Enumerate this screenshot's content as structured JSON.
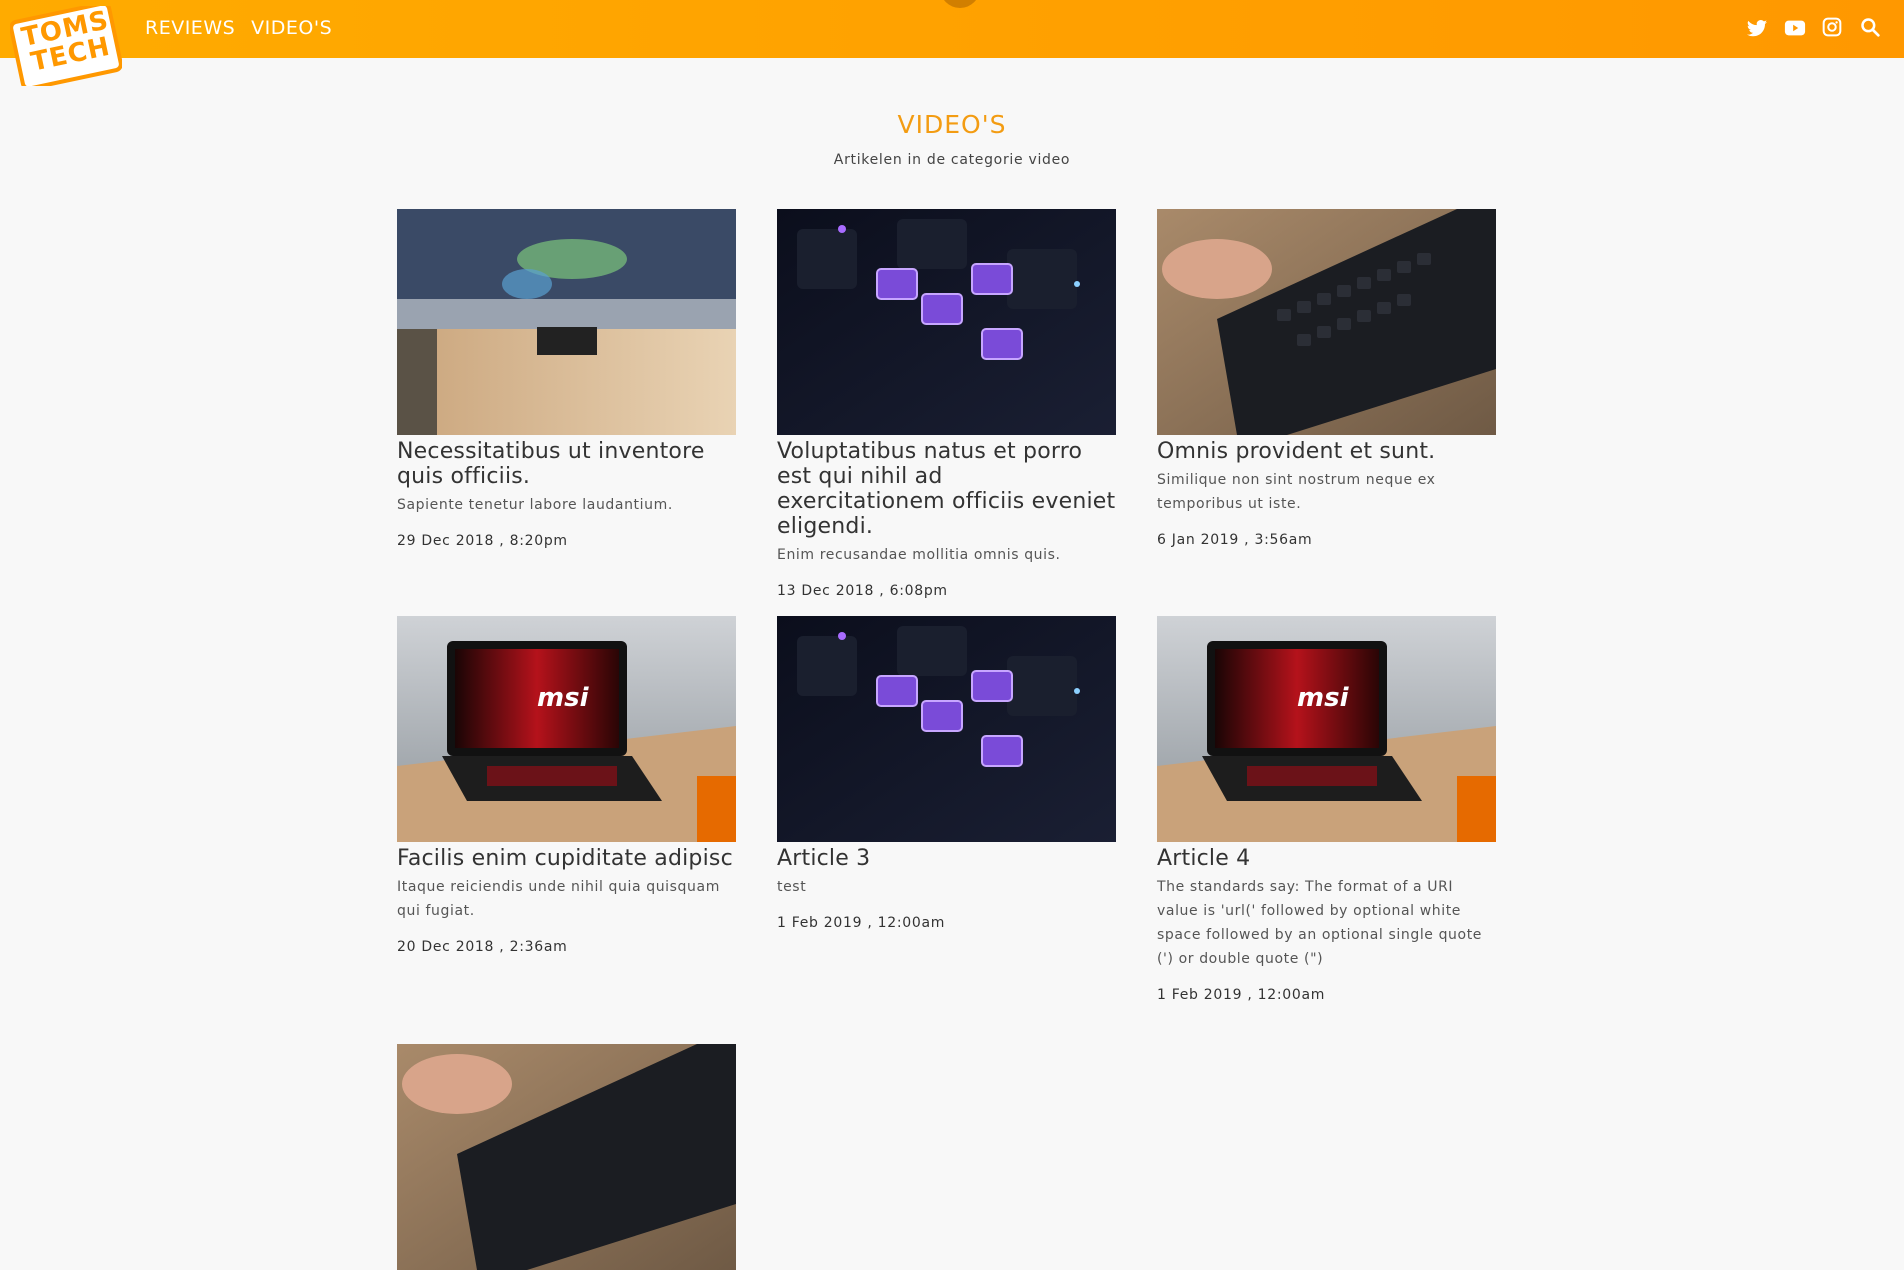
{
  "header": {
    "logo_top": "TOMS",
    "logo_bottom": "TECH",
    "nav": [
      "REVIEWS",
      "VIDEO'S"
    ],
    "social": [
      {
        "name": "twitter-icon"
      },
      {
        "name": "youtube-icon"
      },
      {
        "name": "instagram-icon"
      },
      {
        "name": "search-icon"
      }
    ],
    "colors": {
      "accent": "#ff9800",
      "title": "#f39c12"
    }
  },
  "page": {
    "title": "VIDEO'S",
    "subtitle": "Artikelen in de categorie video"
  },
  "articles": [
    {
      "title": "Necessitatibus ut inventore quis officiis.",
      "excerpt": "Sapiente tenetur labore laudantium.",
      "date": "29 Dec 2018 , 8:20pm",
      "image": "monitor"
    },
    {
      "title": "Voluptatibus natus et porro est qui nihil ad exercitationem officiis eveniet eligendi.",
      "excerpt": "Enim recusandae mollitia omnis quis.",
      "date": "13 Dec 2018 , 6:08pm",
      "image": "switches"
    },
    {
      "title": "Omnis provident et sunt.",
      "excerpt": "Similique non sint nostrum neque ex temporibus ut iste.",
      "date": "6 Jan 2019 , 3:56am",
      "image": "keyboard"
    },
    {
      "title": "Facilis enim cupiditate adipisc",
      "excerpt": "Itaque reiciendis unde nihil quia quisquam qui fugiat.",
      "date": "20 Dec 2018 , 2:36am",
      "image": "laptop",
      "brand": "msi"
    },
    {
      "title": "Article 3",
      "excerpt": "test",
      "date": "1 Feb 2019 , 12:00am",
      "image": "switches"
    },
    {
      "title": "Article 4",
      "excerpt": "The standards say: The format of a URI value is 'url(' followed by optional white space followed by an optional single quote (') or double quote (\")",
      "date": "1 Feb 2019 , 12:00am",
      "image": "laptop",
      "brand": "msi"
    },
    {
      "title": "",
      "excerpt": "",
      "date": "",
      "image": "keyboard"
    }
  ]
}
